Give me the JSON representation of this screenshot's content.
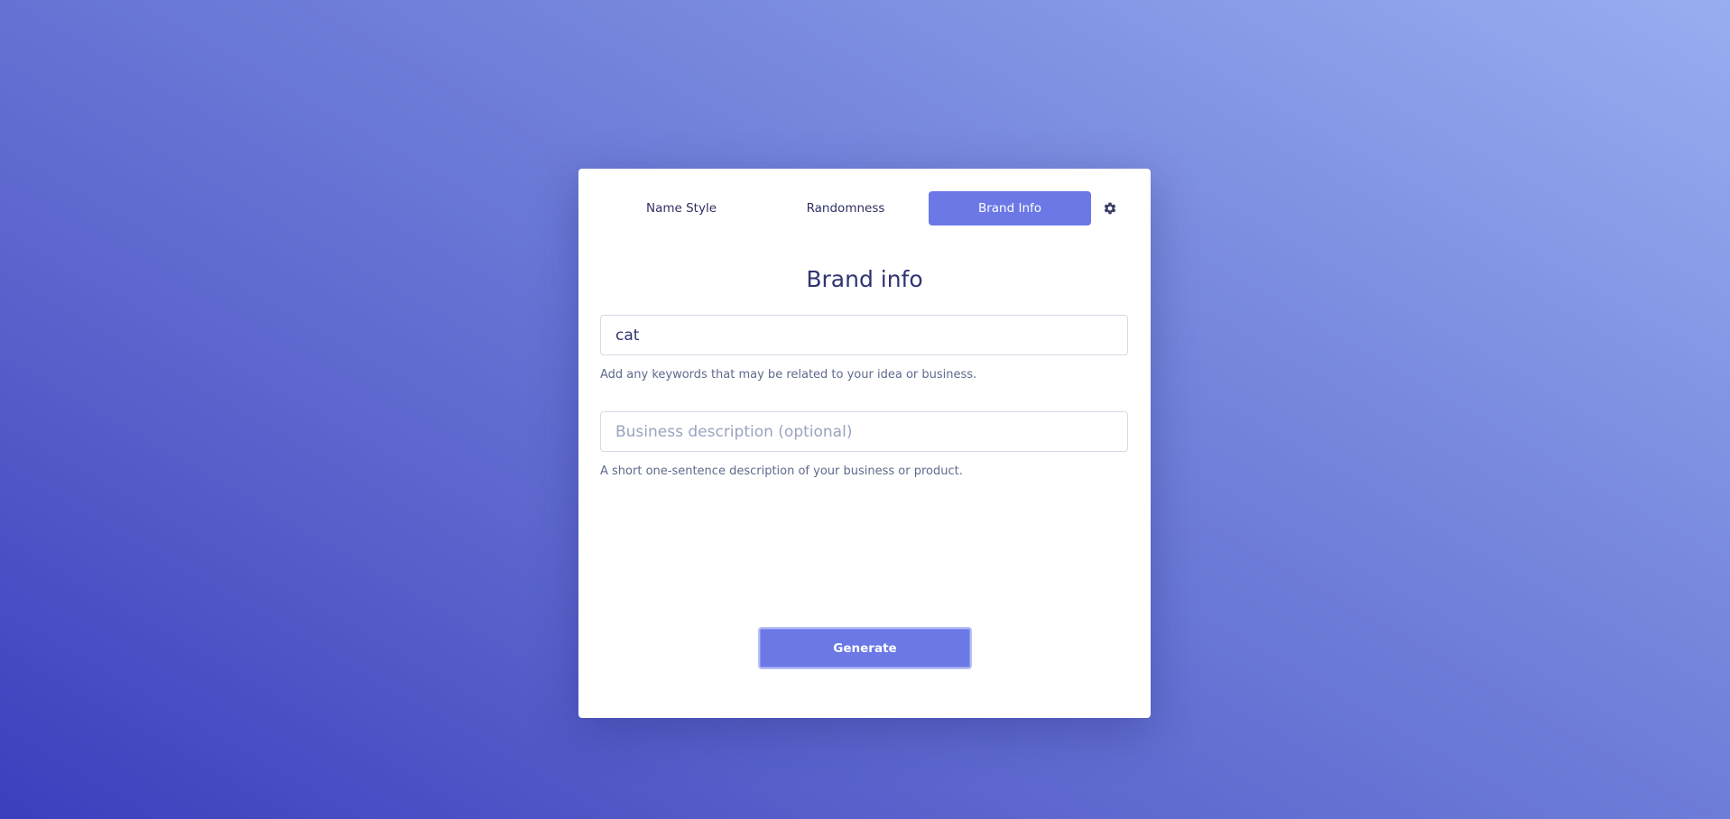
{
  "tabs": [
    {
      "label": "Name Style",
      "active": false
    },
    {
      "label": "Randomness",
      "active": false
    },
    {
      "label": "Brand Info",
      "active": true
    }
  ],
  "settings_icon": "gear-icon",
  "heading": "Brand info",
  "keywords": {
    "value": "cat",
    "hint": "Add any keywords that may be related to your idea or business."
  },
  "description": {
    "value": "",
    "placeholder": "Business description (optional)",
    "hint": "A short one-sentence description of your business or product."
  },
  "generate_label": "Generate",
  "colors": {
    "accent": "#6b78e6",
    "heading": "#2f3472",
    "background_start": "#3b3fbd",
    "background_end": "#97aef0"
  }
}
